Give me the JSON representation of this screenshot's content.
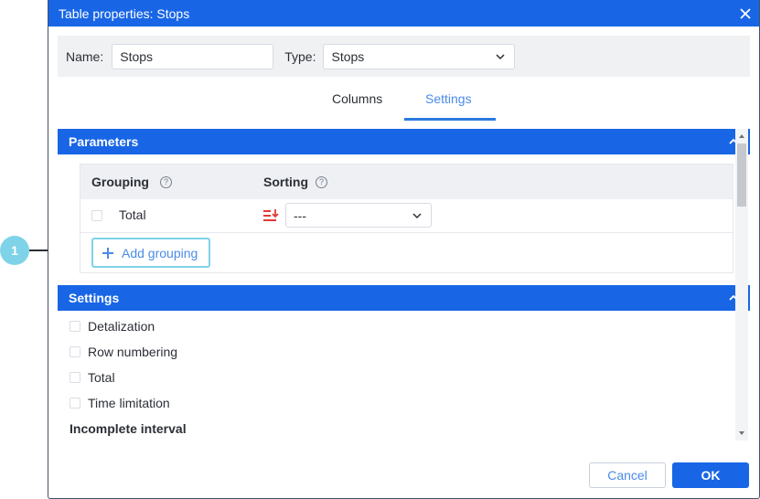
{
  "dialog": {
    "title": "Table properties: Stops"
  },
  "name_bar": {
    "name_label": "Name:",
    "name_value": "Stops",
    "type_label": "Type:",
    "type_value": "Stops"
  },
  "tabs": [
    {
      "label": "Columns",
      "active": false
    },
    {
      "label": "Settings",
      "active": true
    }
  ],
  "parameters": {
    "title": "Parameters",
    "grouping_header": "Grouping",
    "sorting_header": "Sorting",
    "rows": [
      {
        "label": "Total",
        "checked": false,
        "sort_value": "---"
      }
    ],
    "add_grouping_label": "Add grouping"
  },
  "settings": {
    "title": "Settings",
    "items": [
      {
        "label": "Detalization",
        "checked": false
      },
      {
        "label": "Row numbering",
        "checked": false
      },
      {
        "label": "Total",
        "checked": false
      },
      {
        "label": "Time limitation",
        "checked": false
      }
    ],
    "incomplete_interval_label": "Incomplete interval"
  },
  "footer": {
    "cancel_label": "Cancel",
    "ok_label": "OK"
  },
  "annotation": {
    "number": "1"
  },
  "colors": {
    "accent": "#1866e6",
    "callout": "#7fd3e8",
    "sort_icon": "#e53935"
  },
  "icons": {
    "close": "close-icon",
    "chevron": "chevron-down-icon",
    "collapse": "chevron-up-icon",
    "help": "help-circle-icon",
    "sort": "sort-descending-icon",
    "add": "plus-icon"
  }
}
